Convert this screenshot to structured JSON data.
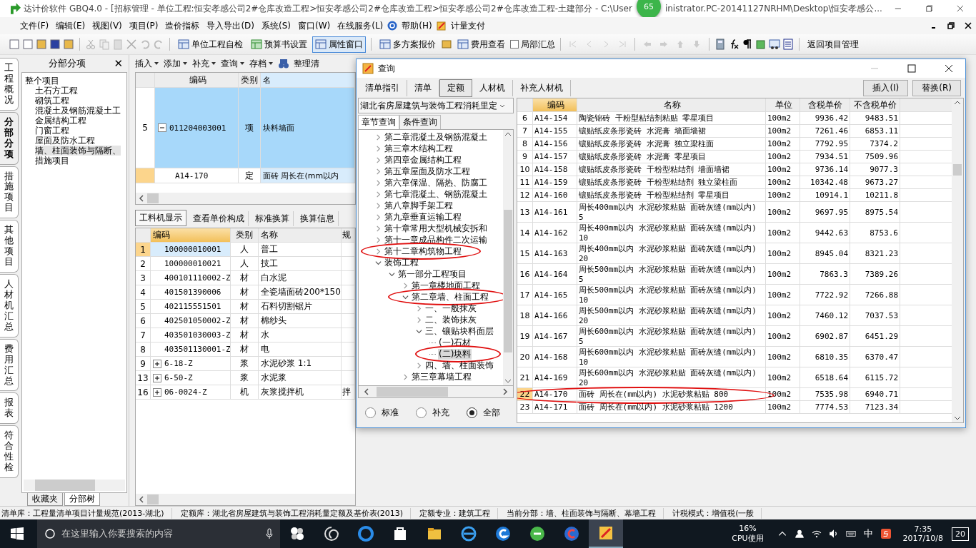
{
  "title_bar": {
    "text_left": "达计价软件 GBQ4.0 - [招标管理 - 单位工程:恒安孝感公司2#仓库改造工程>恒安孝感公司2#仓库改造工程>恒安孝感公司2#仓库改造工程-土建部分 - C:\\User",
    "badge": "65",
    "text_right": "inistrator.PC-20141127NRHM\\Desktop\\恒安孝感公..."
  },
  "menu": [
    "文件(F)",
    "编辑(E)",
    "视图(V)",
    "项目(P)",
    "造价指标",
    "导入导出(D)",
    "系统(S)",
    "窗口(W)",
    "在线服务(L)",
    "帮助(H)",
    "计量支付"
  ],
  "toolbar": [
    {
      "label": "单位工程自检",
      "selected": false
    },
    {
      "label": "预算书设置",
      "selected": false
    },
    {
      "label": "属性窗口",
      "selected": true
    },
    {
      "label": "多方案报价",
      "selected": false
    },
    {
      "label": "费用查看",
      "selected": false
    }
  ],
  "partial_summary": {
    "label": "局部汇总",
    "checked": false
  },
  "return_button": "返回项目管理",
  "side_tabs": [
    {
      "label": "工程概况",
      "selected": false
    },
    {
      "label": "分部分项",
      "selected": true
    },
    {
      "label": "措施项目",
      "selected": false
    },
    {
      "label": "其他项目",
      "selected": false
    },
    {
      "label": "人材机汇总",
      "selected": false
    },
    {
      "label": "费用汇总",
      "selected": false
    },
    {
      "label": "报表",
      "selected": false
    },
    {
      "label": "符合性检",
      "selected": false
    }
  ],
  "tree_panel": {
    "title": "分部分项",
    "close": "✕",
    "root": "整个项目",
    "items": [
      {
        "label": "土石方工程",
        "selected": false
      },
      {
        "label": "砌筑工程",
        "selected": false
      },
      {
        "label": "混凝土及钢筋混凝土工",
        "selected": false
      },
      {
        "label": "金属结构工程",
        "selected": false
      },
      {
        "label": "门窗工程",
        "selected": false
      },
      {
        "label": "屋面及防水工程",
        "selected": false
      },
      {
        "label": "墙、柱面装饰与隔断、",
        "selected": true
      },
      {
        "label": "措施项目",
        "selected": false
      }
    ],
    "bottom_tabs": [
      {
        "label": "收藏夹",
        "selected": false
      },
      {
        "label": "分部树",
        "selected": true
      }
    ]
  },
  "main_toolbar": [
    "插入",
    "添加",
    "补充",
    "查询",
    "存档",
    "整理清"
  ],
  "upper_grid": {
    "columns": [
      "编码",
      "类别",
      "名"
    ],
    "rows": [
      {
        "index": "5",
        "code": "011204003001",
        "type": "项",
        "name": "块料墙面",
        "kind": "item",
        "selected": true,
        "expanded": true
      },
      {
        "index": "",
        "code": "A14-170",
        "type": "定",
        "name": "面砖  周长在(mm以内",
        "kind": "quota",
        "selected": false
      }
    ]
  },
  "lower_tabs": [
    {
      "label": "工料机显示",
      "selected": true
    },
    {
      "label": "查看单价构成",
      "selected": false
    },
    {
      "label": "标准换算",
      "selected": false
    },
    {
      "label": "换算信息",
      "selected": false
    }
  ],
  "lower_grid": {
    "columns": [
      "编码",
      "类别",
      "名称",
      "规"
    ],
    "rows": [
      {
        "index": "1",
        "code": "100000010001",
        "type": "人",
        "name": "普工",
        "selected": true
      },
      {
        "index": "2",
        "code": "100000010021",
        "type": "人",
        "name": "技工",
        "selected": false
      },
      {
        "index": "3",
        "code": "400101110002-Z",
        "type": "材",
        "name": "白水泥",
        "selected": false
      },
      {
        "index": "4",
        "code": "401501390006",
        "type": "材",
        "name": "全瓷墙面砖200*150",
        "selected": false
      },
      {
        "index": "5",
        "code": "402115551501",
        "type": "材",
        "name": "石料切割锯片",
        "selected": false
      },
      {
        "index": "6",
        "code": "402501050002-Z",
        "type": "材",
        "name": "棉纱头",
        "selected": false
      },
      {
        "index": "7",
        "code": "403501030003-Z",
        "type": "材",
        "name": "水",
        "selected": false
      },
      {
        "index": "8",
        "code": "403501130001-Z",
        "type": "材",
        "name": "电",
        "selected": false
      },
      {
        "index": "9",
        "code": "6-18-Z",
        "type": "浆",
        "name": "水泥砂浆  1:1",
        "selected": false,
        "expanded": false
      },
      {
        "index": "13",
        "code": "6-50-Z",
        "type": "浆",
        "name": "水泥浆",
        "selected": false,
        "expanded": false
      },
      {
        "index": "16",
        "code": "06-0024-Z",
        "type": "机",
        "name": "灰浆搅拌机",
        "spec": "拌",
        "selected": false,
        "expanded": false
      }
    ]
  },
  "dialog": {
    "title": "查询",
    "tabs": [
      {
        "label": "清单指引",
        "selected": false
      },
      {
        "label": "清单",
        "selected": false
      },
      {
        "label": "定额",
        "selected": true
      },
      {
        "label": "人材机",
        "selected": false
      },
      {
        "label": "补充人材机",
        "selected": false
      }
    ],
    "buttons": [
      "插入(I)",
      "替换(R)"
    ],
    "library": "湖北省房屋建筑与装饰工程消耗里定",
    "search_tabs": [
      {
        "label": "章节查询",
        "selected": true
      },
      {
        "label": "条件查询",
        "selected": false
      }
    ],
    "tree": [
      {
        "children": [
          {
            "label": "第二章混凝土及钢筋混凝土",
            "expanded": false,
            "selected": false
          },
          {
            "label": "第三章木结构工程",
            "expanded": false,
            "selected": false
          },
          {
            "label": "第四章金属结构工程",
            "expanded": false,
            "selected": false
          },
          {
            "label": "第五章屋面及防水工程",
            "expanded": false,
            "selected": false
          },
          {
            "label": "第六章保温、隔热、防腐工",
            "expanded": false,
            "selected": false
          },
          {
            "label": "第七章混凝土、钢筋混凝土",
            "expanded": false,
            "selected": false
          },
          {
            "label": "第八章脚手架工程",
            "expanded": false,
            "selected": false
          },
          {
            "label": "第九章垂直运输工程",
            "expanded": false,
            "selected": false
          },
          {
            "label": "第十章常用大型机械安拆和",
            "expanded": false,
            "selected": false
          },
          {
            "label": "第十一章成品构件二次运输",
            "expanded": false,
            "selected": false
          },
          {
            "label": "第十二章构筑物工程",
            "expanded": false,
            "selected": false,
            "circled": true
          }
        ]
      },
      {
        "label": "装饰工程",
        "expanded": true,
        "selected": false,
        "children": [
          {
            "label": "第一部分工程项目",
            "expanded": true,
            "selected": false,
            "children": [
              {
                "label": "第一章楼地面工程",
                "expanded": false,
                "selected": false
              },
              {
                "label": "第二章墙、柱面工程",
                "expanded": true,
                "selected": false,
                "circled": true,
                "children": [
                  {
                    "label": "一、一般抹灰",
                    "expanded": false,
                    "selected": false
                  },
                  {
                    "label": "二、装饰抹灰",
                    "expanded": false,
                    "selected": false
                  },
                  {
                    "label": "三、镶贴块料面层",
                    "expanded": true,
                    "selected": false,
                    "children": [
                      {
                        "label": "(一)石材",
                        "kind": "leaf",
                        "selected": false
                      },
                      {
                        "label": "(二)块料",
                        "kind": "leaf",
                        "selected": true,
                        "circled": true
                      }
                    ]
                  },
                  {
                    "label": "四、墙、柱面装饰",
                    "expanded": false,
                    "selected": false
                  }
                ]
              },
              {
                "label": "第三章幕墙工程",
                "expanded": false,
                "selected": false
              }
            ]
          }
        ]
      }
    ],
    "filters": [
      {
        "label": "标准",
        "selected": false
      },
      {
        "label": "补充",
        "selected": false
      },
      {
        "label": "全部",
        "selected": true
      }
    ],
    "table": {
      "columns": [
        "编码",
        "名称",
        "单位",
        "含税单价",
        "不含税单价"
      ],
      "rows": [
        {
          "index": "6",
          "code": "A14-154",
          "name": "陶瓷锦砖  干粉型粘结剂粘贴  零星项目",
          "unit": "100m2",
          "price_tax": "9936.42",
          "price": "9483.51",
          "selected": false
        },
        {
          "index": "7",
          "code": "A14-155",
          "name": "镶贴纸皮条形瓷砖  水泥膏  墙面墙裙",
          "unit": "100m2",
          "price_tax": "7261.46",
          "price": "6853.11",
          "selected": false
        },
        {
          "index": "8",
          "code": "A14-156",
          "name": "镶贴纸皮条形瓷砖  水泥膏  独立梁柱面",
          "unit": "100m2",
          "price_tax": "7792.95",
          "price": "7374.2",
          "selected": false
        },
        {
          "index": "9",
          "code": "A14-157",
          "name": "镶贴纸皮条形瓷砖  水泥膏  零星项目",
          "unit": "100m2",
          "price_tax": "7934.51",
          "price": "7509.96",
          "selected": false
        },
        {
          "index": "10",
          "code": "A14-158",
          "name": "镶贴纸皮条形瓷砖  干粉型粘结剂  墙面墙裙",
          "unit": "100m2",
          "price_tax": "9736.14",
          "price": "9077.3",
          "selected": false
        },
        {
          "index": "11",
          "code": "A14-159",
          "name": "镶贴纸皮条形瓷砖  干粉型粘结剂  独立梁柱面",
          "unit": "100m2",
          "price_tax": "10342.48",
          "price": "9673.27",
          "selected": false
        },
        {
          "index": "12",
          "code": "A14-160",
          "name": "镶贴纸皮条形瓷砖  干粉型粘结剂  零星项目",
          "unit": "100m2",
          "price_tax": "10914.1",
          "price": "10211.8",
          "selected": false
        },
        {
          "index": "13",
          "code": "A14-161",
          "name": "周长400mm以内  水泥砂浆粘贴  面砖灰缝(mm以内)",
          "sub": "5",
          "unit": "100m2",
          "price_tax": "9697.95",
          "price": "8975.54",
          "selected": false
        },
        {
          "index": "14",
          "code": "A14-162",
          "name": "周长400mm以内  水泥砂浆粘贴  面砖灰缝(mm以内)",
          "sub": "10",
          "unit": "100m2",
          "price_tax": "9442.63",
          "price": "8753.6",
          "selected": false
        },
        {
          "index": "15",
          "code": "A14-163",
          "name": "周长400mm以内  水泥砂浆粘贴  面砖灰缝(mm以内)",
          "sub": "20",
          "unit": "100m2",
          "price_tax": "8945.04",
          "price": "8321.23",
          "selected": false
        },
        {
          "index": "16",
          "code": "A14-164",
          "name": "周长500mm以内  水泥砂浆粘贴  面砖灰缝(mm以内)",
          "sub": "5",
          "unit": "100m2",
          "price_tax": "7863.3",
          "price": "7389.26",
          "selected": false
        },
        {
          "index": "17",
          "code": "A14-165",
          "name": "周长500mm以内  水泥砂浆粘贴  面砖灰缝(mm以内)",
          "sub": "10",
          "unit": "100m2",
          "price_tax": "7722.92",
          "price": "7266.88",
          "selected": false
        },
        {
          "index": "18",
          "code": "A14-166",
          "name": "周长500mm以内  水泥砂浆粘贴  面砖灰缝(mm以内)",
          "sub": "20",
          "unit": "100m2",
          "price_tax": "7460.12",
          "price": "7037.53",
          "selected": false
        },
        {
          "index": "19",
          "code": "A14-167",
          "name": "周长600mm以内  水泥砂浆粘贴  面砖灰缝(mm以内)",
          "sub": "5",
          "unit": "100m2",
          "price_tax": "6902.87",
          "price": "6451.29",
          "selected": false
        },
        {
          "index": "20",
          "code": "A14-168",
          "name": "周长600mm以内  水泥砂浆粘贴  面砖灰缝(mm以内)",
          "sub": "10",
          "unit": "100m2",
          "price_tax": "6810.35",
          "price": "6370.47",
          "selected": false
        },
        {
          "index": "21",
          "code": "A14-169",
          "name": "周长600mm以内  水泥砂浆粘贴  面砖灰缝(mm以内)",
          "sub": "20",
          "unit": "100m2",
          "price_tax": "6518.64",
          "price": "6115.72",
          "selected": false
        },
        {
          "index": "22",
          "code": "A14-170",
          "name": "面砖  周长在(mm以内)  水泥砂浆粘贴  800",
          "unit": "100m2",
          "price_tax": "7535.98",
          "price": "6940.71",
          "selected": true,
          "circled": true
        },
        {
          "index": "23",
          "code": "A14-171",
          "name": "面砖  周长在(mm以内)  水泥砂浆粘贴  1200",
          "unit": "100m2",
          "price_tax": "7774.53",
          "price": "7123.34",
          "selected": false
        }
      ]
    }
  },
  "status_bar": [
    "清单库：工程量清单项目计量规范(2013-湖北)",
    "定额库：湖北省房屋建筑与装饰工程消耗量定额及基价表(2013)",
    "定额专业：建筑工程",
    "当前分部：墙、柱面装饰与隔断、幕墙工程",
    "计税模式：增值税(一般"
  ],
  "taskbar": {
    "search_placeholder": "在这里输入你要搜索的内容",
    "cpu": "16%",
    "cpu_label": "CPU使用",
    "ime": "中",
    "time": "7:35",
    "date": "2017/10/8",
    "notifications": "20"
  }
}
